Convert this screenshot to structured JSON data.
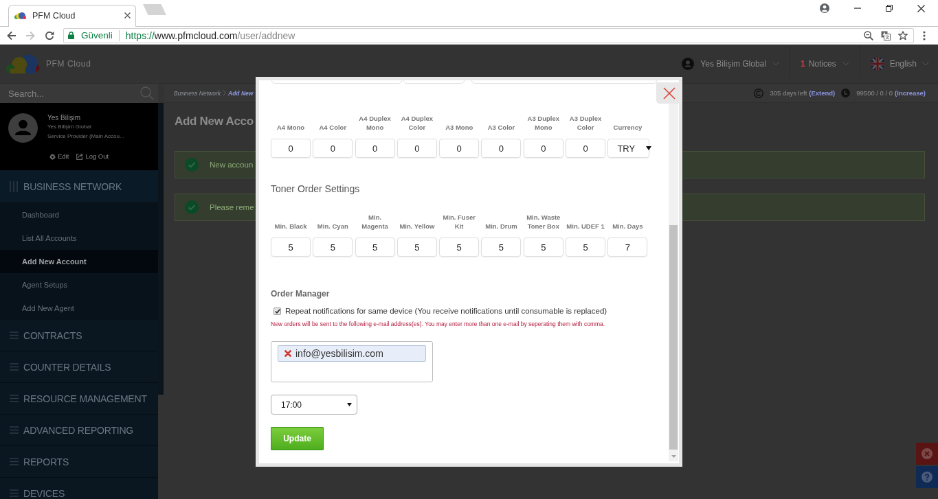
{
  "browser": {
    "tab_title": "PFM Cloud",
    "security_label": "Güvenli",
    "url": {
      "scheme": "https://",
      "host": "www.pfmcloud.com",
      "path": "/user/addnew"
    }
  },
  "header": {
    "brand": "PFM Cloud",
    "account": "Yes Bilişim Global",
    "notice_count": "1",
    "notices_label": "Notices",
    "language": "English"
  },
  "sidebar": {
    "search": {
      "placeholder": "Search..."
    },
    "profile": {
      "name": "Yes Bilişim",
      "company": "Yes Bilişim Global",
      "role": "Service Provider (Main Accou...",
      "edit_label": "Edit",
      "logout_label": "Log Out"
    },
    "sections": [
      {
        "label": "BUSINESS NETWORK",
        "expanded": true,
        "children": [
          {
            "label": "Dashboard",
            "selected": false
          },
          {
            "label": "List All Accounts",
            "selected": false
          },
          {
            "label": "Add New Account",
            "selected": true
          },
          {
            "label": "Agent Setups",
            "selected": false
          },
          {
            "label": "Add New Agent",
            "selected": false
          }
        ]
      },
      {
        "label": "CONTRACTS",
        "expanded": false
      },
      {
        "label": "COUNTER DETAILS",
        "expanded": false
      },
      {
        "label": "RESOURCE MANAGEMENT",
        "expanded": false
      },
      {
        "label": "ADVANCED REPORTING",
        "expanded": false
      },
      {
        "label": "REPORTS",
        "expanded": false
      },
      {
        "label": "DEVICES",
        "expanded": false
      }
    ]
  },
  "breadcrumb": [
    {
      "label": "Business Network",
      "current": false
    },
    {
      "label": "Add New",
      "current": true
    }
  ],
  "status_bar": {
    "days_left": "305 days left",
    "extend_link": "(Extend)",
    "quota": "99500 / 0 / 0",
    "increase_link": "(Increase)"
  },
  "page": {
    "title": "Add New Acco",
    "alerts": [
      "New accoun",
      "Please reme"
    ]
  },
  "modal": {
    "price_fields": [
      {
        "label": "A4 Mono",
        "kind": "number",
        "value": "0"
      },
      {
        "label": "A4 Color",
        "kind": "number",
        "value": "0"
      },
      {
        "label": "A4 Duplex Mono",
        "kind": "number",
        "value": "0"
      },
      {
        "label": "A4 Duplex Color",
        "kind": "number",
        "value": "0"
      },
      {
        "label": "A3 Mono",
        "kind": "number",
        "value": "0"
      },
      {
        "label": "A3 Color",
        "kind": "number",
        "value": "0"
      },
      {
        "label": "A3 Duplex Mono",
        "kind": "number",
        "value": "0"
      },
      {
        "label": "A3 Duplex Color",
        "kind": "number",
        "value": "0"
      },
      {
        "label": "Currency",
        "kind": "select",
        "value": "TRY"
      }
    ],
    "toner_heading": "Toner Order Settings",
    "toner_fields": [
      {
        "label": "Min. Black",
        "kind": "number",
        "value": "5"
      },
      {
        "label": "Min. Cyan",
        "kind": "number",
        "value": "5"
      },
      {
        "label": "Min. Magenta",
        "kind": "number",
        "value": "5"
      },
      {
        "label": "Min. Yellow",
        "kind": "number",
        "value": "5"
      },
      {
        "label": "Min. Fuser Kit",
        "kind": "number",
        "value": "5"
      },
      {
        "label": "Min. Drum",
        "kind": "number",
        "value": "5"
      },
      {
        "label": "Min. Waste Toner Box",
        "kind": "number",
        "value": "5"
      },
      {
        "label": "Min. UDEF 1",
        "kind": "number",
        "value": "5"
      },
      {
        "label": "Min. Days",
        "kind": "number",
        "value": "7"
      }
    ],
    "order_manager": {
      "heading": "Order Manager",
      "repeat": {
        "label": "Repeat notifications for same device (You receive notifications until consumable is replaced)",
        "checked": true
      },
      "note": "New orders will be sent to the following e-mail address(es). You may enter more than one e-mail by seperating them with comma.",
      "emails": [
        "info@yesbilisim.com"
      ],
      "send_time": "17:00",
      "submit": "Update"
    }
  }
}
